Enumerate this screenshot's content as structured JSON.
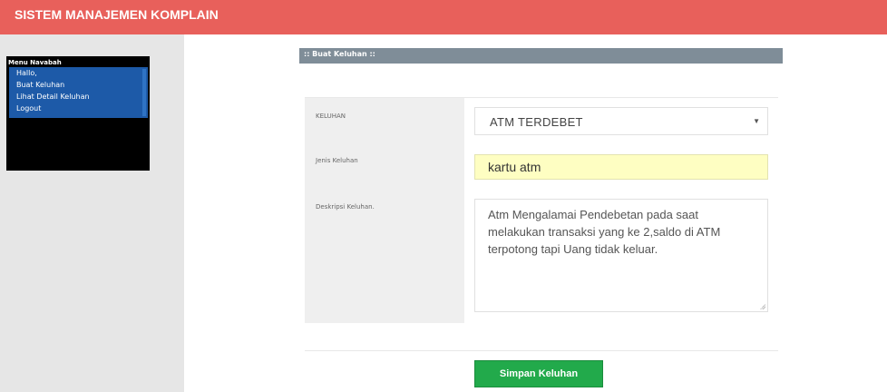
{
  "header": {
    "title": "SISTEM MANAJEMEN KOMPLAIN"
  },
  "sidebar": {
    "menu_title": "Menu Navabah",
    "items": [
      {
        "label": "Hallo,"
      },
      {
        "label": "Buat Keluhan"
      },
      {
        "label": "Lihat Detail Keluhan"
      },
      {
        "label": "Logout"
      }
    ]
  },
  "panel": {
    "title": ":: Buat Keluhan ::"
  },
  "form": {
    "keluhan_label": "KELUHAN",
    "keluhan_value": "ATM TERDEBET",
    "jenis_label": "Jenis Keluhan",
    "jenis_value": "kartu atm",
    "deskripsi_label": "Deskripsi Keluhan.",
    "deskripsi_value": "Atm Mengalamai Pendebetan pada saat melakukan transaksi yang ke 2,saldo di ATM terpotong tapi Uang tidak keluar."
  },
  "actions": {
    "save_label": "Simpan Keluhan"
  },
  "colors": {
    "header_bg": "#e8605b",
    "button_bg": "#22aa4b",
    "panel_bar": "#7f8d98",
    "input_highlight": "#fefec2"
  }
}
